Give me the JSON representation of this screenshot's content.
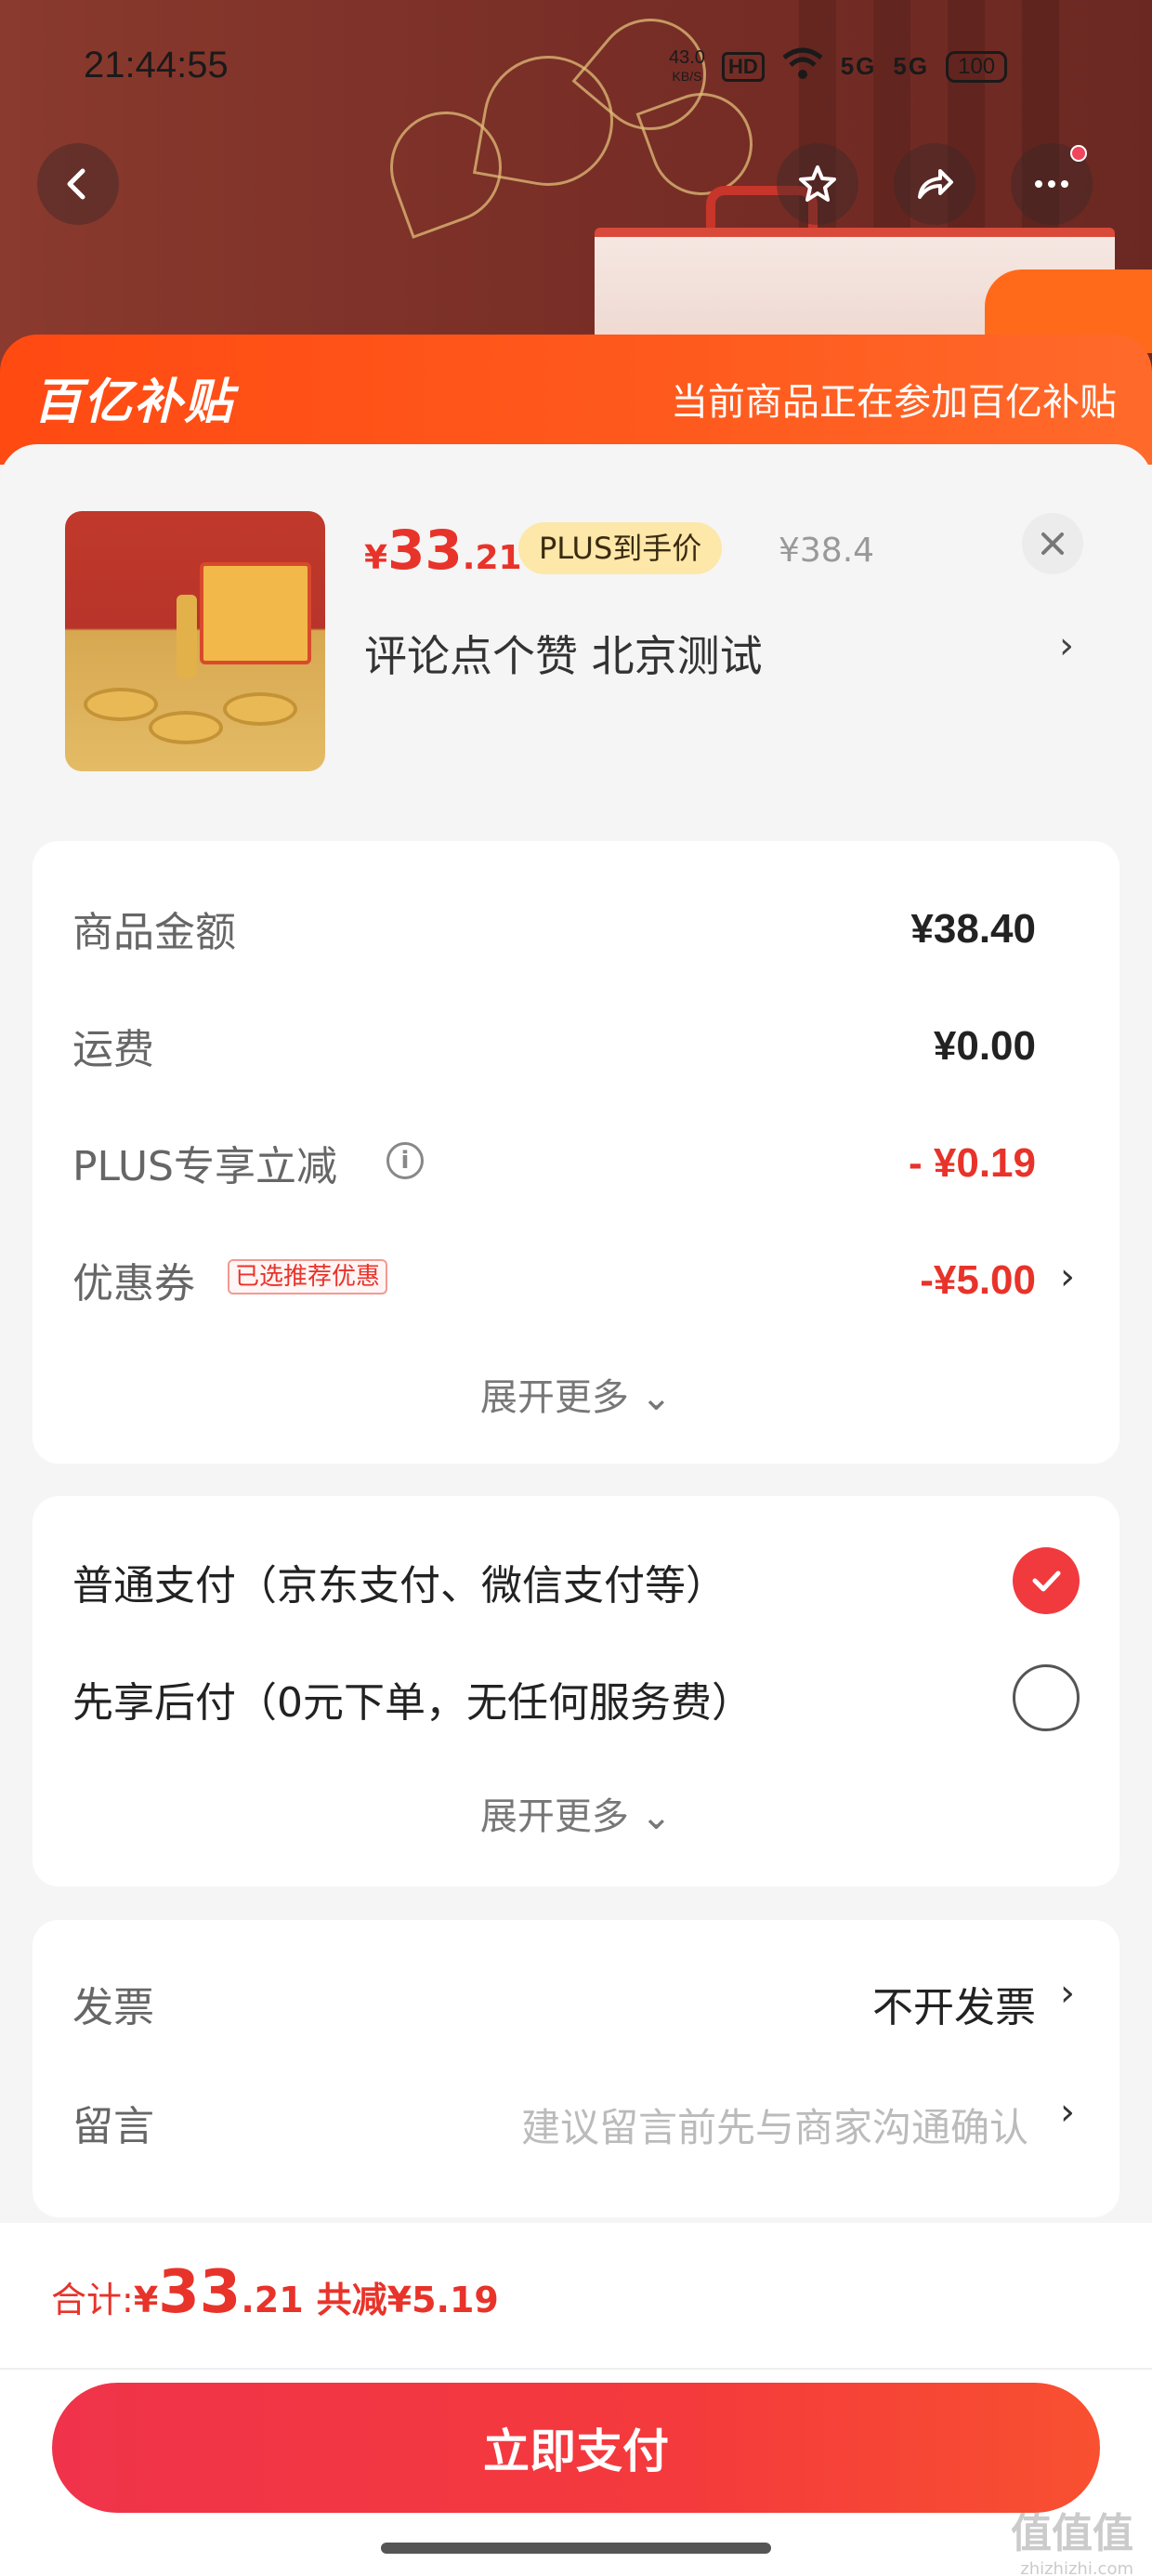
{
  "status_bar": {
    "time": "21:44:55",
    "net_speed": "43.0",
    "net_unit": "KB/S",
    "hd": "HD",
    "signal1": "5G",
    "signal2": "5G",
    "battery": "100"
  },
  "hero": {
    "icons": [
      "back-arrow-icon",
      "star-icon",
      "share-icon",
      "more-dots-icon"
    ]
  },
  "banner": {
    "logo": "百亿补贴",
    "notice": "当前商品正在参加百亿补贴"
  },
  "product": {
    "price_symbol": "¥",
    "price_int": "33",
    "price_dec": ".21",
    "plus_badge": "PLUS到手价",
    "original_price": "¥38.4",
    "title": "评论点个赞 北京测试",
    "arrow": "›"
  },
  "fees": {
    "rows": [
      {
        "label": "商品金额",
        "value": "¥38.40"
      },
      {
        "label": "运费",
        "value": "¥0.00"
      },
      {
        "label": "PLUS专享立减",
        "value": "- ¥0.19"
      },
      {
        "label": "优惠券",
        "tag": "已选推荐优惠",
        "value": "-¥5.00"
      }
    ],
    "expand": "展开更多 ⌄"
  },
  "payment": {
    "options": [
      {
        "label": "普通支付（京东支付、微信支付等）",
        "selected": true
      },
      {
        "label": "先享后付（0元下单，无任何服务费）",
        "selected": false
      }
    ],
    "expand": "展开更多 ⌄"
  },
  "extra": {
    "invoice_label": "发票",
    "invoice_value": "不开发票",
    "note_label": "留言",
    "note_placeholder": "建议留言前先与商家沟通确认"
  },
  "footer": {
    "total_label": "合计: ",
    "total_symbol": "¥",
    "total_int": "33",
    "total_dec": ".21",
    "saving": "共减¥5.19",
    "pay_button": "立即支付"
  },
  "watermark": {
    "main": "值值值",
    "sub": "zhizhizhi.com"
  },
  "colors": {
    "accent": "#e8332a",
    "banner": "#ff4a12",
    "pay_button": "#f0334a",
    "plus_badge_bg": "#fde7a9"
  }
}
